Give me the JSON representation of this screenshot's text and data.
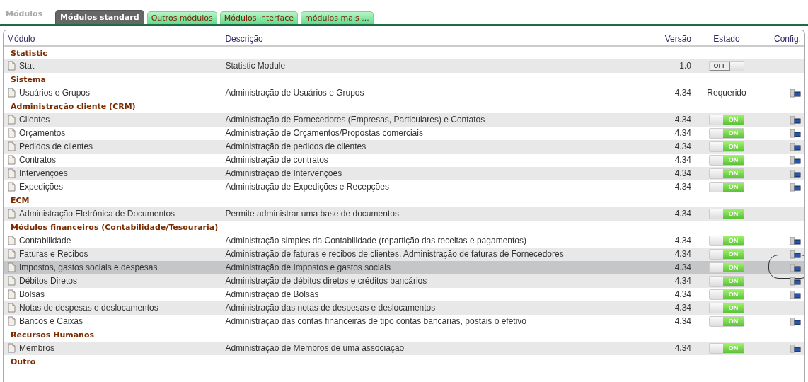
{
  "page_title": "Módulos",
  "tabs": [
    {
      "label": "Módulos standard",
      "selected": true
    },
    {
      "label": "Outros módulos",
      "selected": false
    },
    {
      "label": "Módulos interface",
      "selected": false
    },
    {
      "label": "módulos mais ...",
      "selected": false
    }
  ],
  "table": {
    "columns": [
      "Módulo",
      "Descrição",
      "Versão",
      "Estado",
      "Config."
    ],
    "groups": [
      {
        "title": "Statistic",
        "rows": [
          {
            "name": "Stat",
            "description": "Statistic Module",
            "version": "1.0",
            "state": {
              "kind": "toggle",
              "on": false,
              "label": "OFF"
            },
            "config": false,
            "selected": false,
            "circled": false
          }
        ]
      },
      {
        "title": "Sistema",
        "rows": [
          {
            "name": "Usuários e Grupos",
            "description": "Administração de Usuários e Grupos",
            "version": "4.34",
            "state": {
              "kind": "text",
              "label": "Requerido"
            },
            "config": true,
            "selected": false,
            "circled": false
          }
        ]
      },
      {
        "title": "Administração cliente (CRM)",
        "rows": [
          {
            "name": "Clientes",
            "description": "Administração de Fornecedores (Empresas, Particulares) e Contatos",
            "version": "4.34",
            "state": {
              "kind": "toggle",
              "on": true,
              "label": "ON"
            },
            "config": true,
            "selected": false,
            "circled": false
          },
          {
            "name": "Orçamentos",
            "description": "Administração de Orçamentos/Propostas comerciais",
            "version": "4.34",
            "state": {
              "kind": "toggle",
              "on": true,
              "label": "ON"
            },
            "config": true,
            "selected": false,
            "circled": false
          },
          {
            "name": "Pedidos de clientes",
            "description": "Administração de pedidos de clientes",
            "version": "4.34",
            "state": {
              "kind": "toggle",
              "on": true,
              "label": "ON"
            },
            "config": true,
            "selected": false,
            "circled": false
          },
          {
            "name": "Contratos",
            "description": "Administração de contratos",
            "version": "4.34",
            "state": {
              "kind": "toggle",
              "on": true,
              "label": "ON"
            },
            "config": true,
            "selected": false,
            "circled": false
          },
          {
            "name": "Intervenções",
            "description": "Administração de Intervenções",
            "version": "4.34",
            "state": {
              "kind": "toggle",
              "on": true,
              "label": "ON"
            },
            "config": true,
            "selected": false,
            "circled": false
          },
          {
            "name": "Expedições",
            "description": "Administração de Expedições e Recepções",
            "version": "4.34",
            "state": {
              "kind": "toggle",
              "on": true,
              "label": "ON"
            },
            "config": true,
            "selected": false,
            "circled": false
          }
        ]
      },
      {
        "title": "ECM",
        "rows": [
          {
            "name": "Administração Eletrônica de Documentos",
            "description": "Permite administrar uma base de documentos",
            "version": "4.34",
            "state": {
              "kind": "toggle",
              "on": true,
              "label": "ON"
            },
            "config": false,
            "selected": false,
            "circled": false
          }
        ]
      },
      {
        "title": "Módulos financeiros (Contabilidade/Tesouraria)",
        "rows": [
          {
            "name": "Contabilidade",
            "description": "Administração simples da Contabilidade (repartição das receitas e pagamentos)",
            "version": "4.34",
            "state": {
              "kind": "toggle",
              "on": true,
              "label": "ON"
            },
            "config": true,
            "selected": false,
            "circled": false
          },
          {
            "name": "Faturas e Recibos",
            "description": "Administração de faturas e recibos de clientes. Administração de faturas de Fornecedores",
            "version": "4.34",
            "state": {
              "kind": "toggle",
              "on": true,
              "label": "ON"
            },
            "config": true,
            "selected": false,
            "circled": false
          },
          {
            "name": "Impostos, gastos sociais e despesas",
            "description": "Administração de Impostos e gastos sociais",
            "version": "4.34",
            "state": {
              "kind": "toggle",
              "on": true,
              "label": "ON"
            },
            "config": true,
            "selected": true,
            "circled": true
          },
          {
            "name": "Débitos Diretos",
            "description": "Administração de débitos diretos e créditos bancários",
            "version": "4.34",
            "state": {
              "kind": "toggle",
              "on": true,
              "label": "ON"
            },
            "config": true,
            "selected": false,
            "circled": false
          },
          {
            "name": "Bolsas",
            "description": "Administração de Bolsas",
            "version": "4.34",
            "state": {
              "kind": "toggle",
              "on": true,
              "label": "ON"
            },
            "config": true,
            "selected": false,
            "circled": false
          },
          {
            "name": "Notas de despesas e deslocamentos",
            "description": "Administração das notas de despesas e deslocamentos",
            "version": "4.34",
            "state": {
              "kind": "toggle",
              "on": true,
              "label": "ON"
            },
            "config": false,
            "selected": false,
            "circled": false
          },
          {
            "name": "Bancos e Caixas",
            "description": "Administração das contas financeiras de tipo contas bancarias, postais o efetivo",
            "version": "4.34",
            "state": {
              "kind": "toggle",
              "on": true,
              "label": "ON"
            },
            "config": true,
            "selected": false,
            "circled": false
          }
        ]
      },
      {
        "title": "Recursos Humanos",
        "rows": [
          {
            "name": "Membros",
            "description": "Administração de Membros de uma associação",
            "version": "4.34",
            "state": {
              "kind": "toggle",
              "on": true,
              "label": "ON"
            },
            "config": true,
            "selected": false,
            "circled": false
          }
        ]
      },
      {
        "title": "Outro"
      }
    ]
  }
}
